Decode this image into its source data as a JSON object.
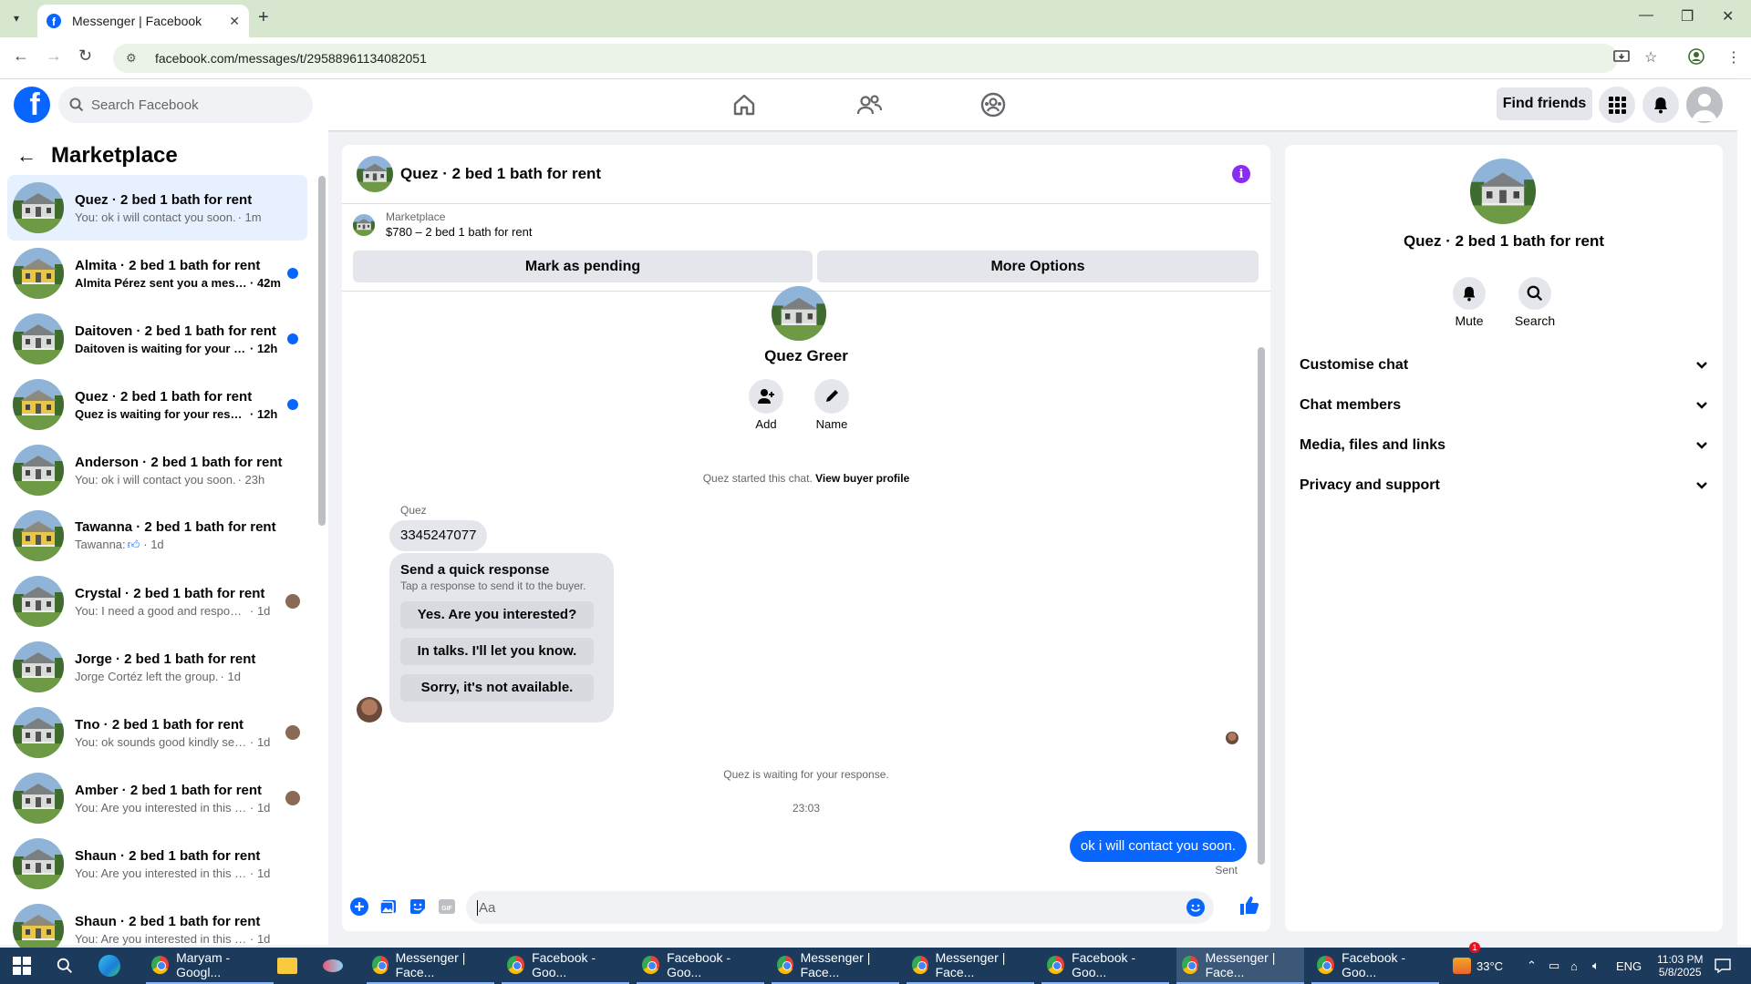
{
  "browser": {
    "tab_title": "Messenger | Facebook",
    "url": "facebook.com/messages/t/29588961134082051",
    "new_tab_symbol": "+",
    "window_minimize": "—",
    "window_restore": "❐",
    "window_close": "✕"
  },
  "header": {
    "search_placeholder": "Search Facebook",
    "find_friends_label": "Find friends"
  },
  "sidebar": {
    "title": "Marketplace",
    "conversations": [
      {
        "name": "Quez · 2 bed 1 bath for rent",
        "preview": "You: ok i will contact you soon.",
        "time": "· 1m",
        "active": true,
        "unread": false,
        "house": "gray"
      },
      {
        "name": "Almita · 2 bed 1 bath for rent",
        "preview": "Almita Pérez sent you a messa...",
        "time": "· 42m",
        "unread": true,
        "house": "yellow"
      },
      {
        "name": "Daitoven · 2 bed 1 bath for rent",
        "preview": "Daitoven is waiting for your re...",
        "time": "· 12h",
        "unread": true,
        "house": "gray"
      },
      {
        "name": "Quez · 2 bed 1 bath for rent",
        "preview": "Quez is waiting for your respo...",
        "time": "· 12h",
        "unread": true,
        "house": "yellow"
      },
      {
        "name": "Anderson · 2 bed 1 bath for rent",
        "preview": "You: ok i will contact you soon.",
        "time": "· 23h",
        "unread": false,
        "house": "gray"
      },
      {
        "name": "Tawanna · 2 bed 1 bath for rent",
        "preview": "Tawanna:",
        "time": "· 1d",
        "unread": false,
        "house": "yellow",
        "thumbs": true
      },
      {
        "name": "Crystal · 2 bed 1 bath for rent",
        "preview": "You: I need a good and responsibl...",
        "time": "· 1d",
        "unread": false,
        "house": "gray",
        "seen": true
      },
      {
        "name": "Jorge · 2 bed 1 bath for rent",
        "preview": "Jorge Cortéz left the group.",
        "time": "· 1d",
        "unread": false,
        "house": "gray"
      },
      {
        "name": "Tno · 2 bed 1 bath for rent",
        "preview": "You: ok sounds good kindly sen...",
        "time": "· 1d",
        "unread": false,
        "house": "gray",
        "seen": true
      },
      {
        "name": "Amber · 2 bed 1 bath for rent",
        "preview": "You: Are you interested in this pr...",
        "time": "· 1d",
        "unread": false,
        "house": "gray",
        "seen": true
      },
      {
        "name": "Shaun · 2 bed 1 bath for rent",
        "preview": "You: Are you interested in this prop...",
        "time": "· 1d",
        "unread": false,
        "house": "gray"
      },
      {
        "name": "Shaun · 2 bed 1 bath for rent",
        "preview": "You: Are you interested in this prop...",
        "time": "· 1d",
        "unread": false,
        "house": "yellow"
      }
    ]
  },
  "chat": {
    "title": "Quez · 2 bed 1 bath for rent",
    "listing_source": "Marketplace",
    "listing_detail": "$780 – 2 bed 1 bath for rent",
    "mark_pending_label": "Mark as pending",
    "more_options_label": "More Options",
    "profile_name": "Quez Greer",
    "add_label": "Add",
    "name_label": "Name",
    "started_text": "Quez started this chat.",
    "view_buyer_profile": "View buyer profile",
    "sender_name": "Quez",
    "phone_message": "3345247077",
    "quick_response_title": "Send a quick response",
    "quick_response_subtitle": "Tap a response to send it to the buyer.",
    "quick_responses": [
      "Yes. Are you interested?",
      "In talks. I'll let you know.",
      "Sorry, it's not available."
    ],
    "waiting_text": "Quez is waiting for your response.",
    "timestamp": "23:03",
    "outgoing_message": "ok i will contact you soon.",
    "sent_status": "Sent",
    "input_placeholder": "Aa"
  },
  "details": {
    "title": "Quez · 2 bed 1 bath for rent",
    "mute_label": "Mute",
    "search_label": "Search",
    "sections": [
      "Customise chat",
      "Chat members",
      "Media, files and links",
      "Privacy and support"
    ]
  },
  "taskbar": {
    "apps": [
      "Maryam - Googl...",
      "Messenger | Face...",
      "Facebook - Goo...",
      "Facebook - Goo...",
      "Messenger | Face...",
      "Messenger | Face...",
      "Facebook - Goo...",
      "Messenger | Face...",
      "Facebook - Goo..."
    ],
    "temperature": "33°C",
    "language": "ENG",
    "time": "11:03 PM",
    "date": "5/8/2025",
    "notification_count": "1"
  },
  "colors": {
    "accent": "#0866ff",
    "active_conv": "#e7f0fe",
    "info": "#8b2cf5",
    "taskbar": "#1c3a5c"
  }
}
